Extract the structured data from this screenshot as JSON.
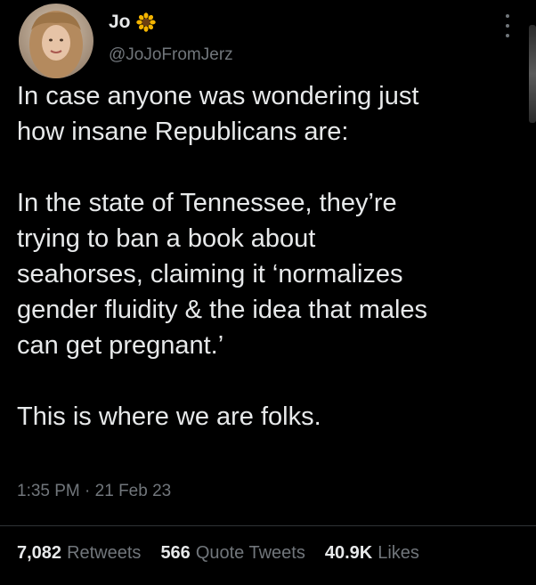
{
  "author": {
    "display_name": "Jo",
    "handle": "@JoJoFromJerz",
    "name_emoji": "sunflower-icon"
  },
  "tweet": {
    "paragraphs": [
      [
        "In case anyone was wondering just",
        "how insane Republicans are:"
      ],
      [
        "In the state of Tennessee, they’re",
        "trying to ban a book about",
        "seahorses, claiming it ‘normalizes",
        "gender fluidity & the idea that males",
        "can get pregnant.’"
      ],
      [
        "This is where we are folks."
      ]
    ],
    "time": "1:35 PM",
    "separator": "·",
    "date": "21 Feb 23"
  },
  "stats": {
    "retweets_count": "7,082",
    "retweets_label": "Retweets",
    "quotes_count": "566",
    "quotes_label": "Quote Tweets",
    "likes_count": "40.9K",
    "likes_label": "Likes"
  },
  "colors": {
    "background": "#000000",
    "text": "#e7e9ea",
    "secondary": "#71767b",
    "divider": "#2f3336"
  }
}
